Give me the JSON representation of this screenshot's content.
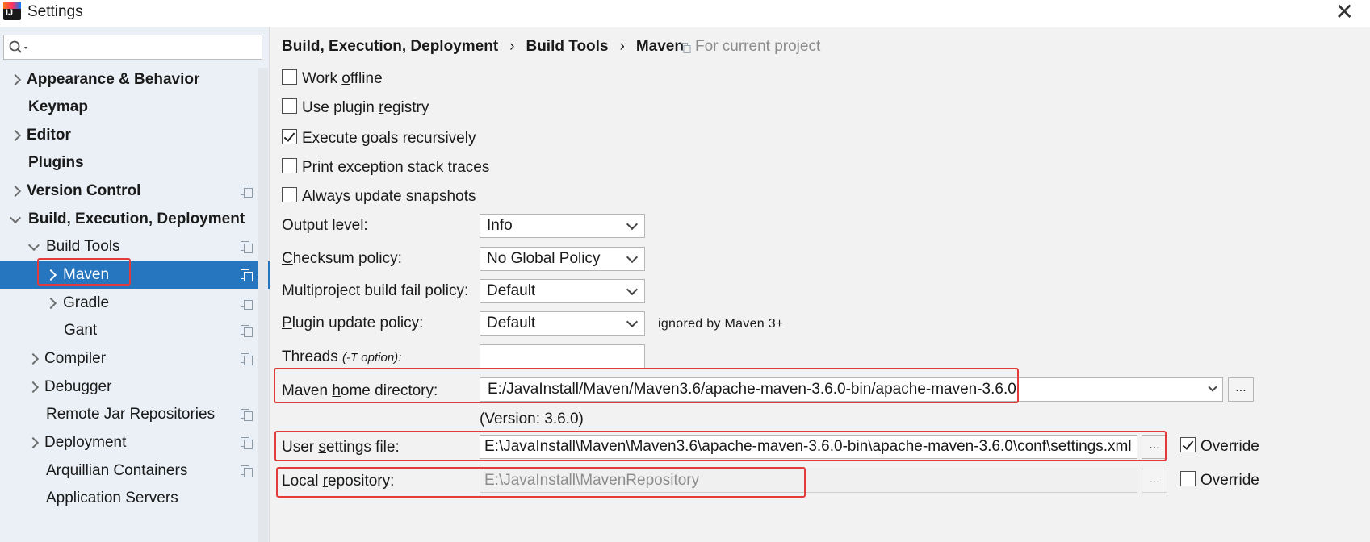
{
  "window": {
    "title": "Settings"
  },
  "search": {
    "placeholder": ""
  },
  "sidebar": {
    "items": [
      {
        "label": "Appearance & Behavior"
      },
      {
        "label": "Keymap"
      },
      {
        "label": "Editor"
      },
      {
        "label": "Plugins"
      },
      {
        "label": "Version Control"
      },
      {
        "label": "Build, Execution, Deployment"
      },
      {
        "label": "Build Tools"
      },
      {
        "label": "Maven"
      },
      {
        "label": "Gradle"
      },
      {
        "label": "Gant"
      },
      {
        "label": "Compiler"
      },
      {
        "label": "Debugger"
      },
      {
        "label": "Remote Jar Repositories"
      },
      {
        "label": "Deployment"
      },
      {
        "label": "Arquillian Containers"
      },
      {
        "label": "Application Servers"
      }
    ]
  },
  "breadcrumb": {
    "items": [
      "Build, Execution, Deployment",
      "Build Tools",
      "Maven"
    ],
    "separator": "›",
    "scope": "For current project"
  },
  "checkboxes": [
    {
      "pre": "Work ",
      "mn": "o",
      "post": "ffline",
      "checked": false
    },
    {
      "pre": "Use plugin ",
      "mn": "r",
      "post": "egistry",
      "checked": false
    },
    {
      "pre": "Execute ",
      "mn": "g",
      "post": "oals recursively",
      "checked": true
    },
    {
      "pre": "Print ",
      "mn": "e",
      "post": "xception stack traces",
      "checked": false
    },
    {
      "pre": "Always update ",
      "mn": "s",
      "post": "napshots",
      "checked": false
    }
  ],
  "fields": {
    "output_level": {
      "pre": "Output ",
      "mn": "l",
      "post": "evel:",
      "value": "Info"
    },
    "checksum_policy": {
      "pre": "",
      "mn": "C",
      "post": "hecksum policy:",
      "value": "No Global Policy"
    },
    "multiproject_policy": {
      "label": "Multiproject build fail policy:",
      "value": "Default"
    },
    "plugin_update_policy": {
      "pre": "",
      "mn": "P",
      "post": "lugin update policy:",
      "value": "Default",
      "note": "ignored by Maven 3+"
    },
    "threads": {
      "label": "Threads",
      "hint": "(-T option):",
      "value": ""
    },
    "maven_home": {
      "pre": "Maven ",
      "mn": "h",
      "post": "ome directory:",
      "value": "E:/JavaInstall/Maven/Maven3.6/apache-maven-3.6.0-bin/apache-maven-3.6.0",
      "version": "(Version: 3.6.0)"
    },
    "user_settings": {
      "pre": "User ",
      "mn": "s",
      "post": "ettings file:",
      "value": "E:\\JavaInstall\\Maven\\Maven3.6\\apache-maven-3.6.0-bin\\apache-maven-3.6.0\\conf\\settings.xml",
      "override_label": "Override",
      "override": true
    },
    "local_repo": {
      "pre": "Local ",
      "mn": "r",
      "post": "epository:",
      "value": "E:\\JavaInstall\\MavenRepository",
      "override_label": "Override",
      "override": false
    }
  },
  "browse_label": "...",
  "colors": {
    "selection": "#2675bf",
    "highlight": "#e23b3b",
    "sidebar_bg": "#eaf0f6"
  }
}
